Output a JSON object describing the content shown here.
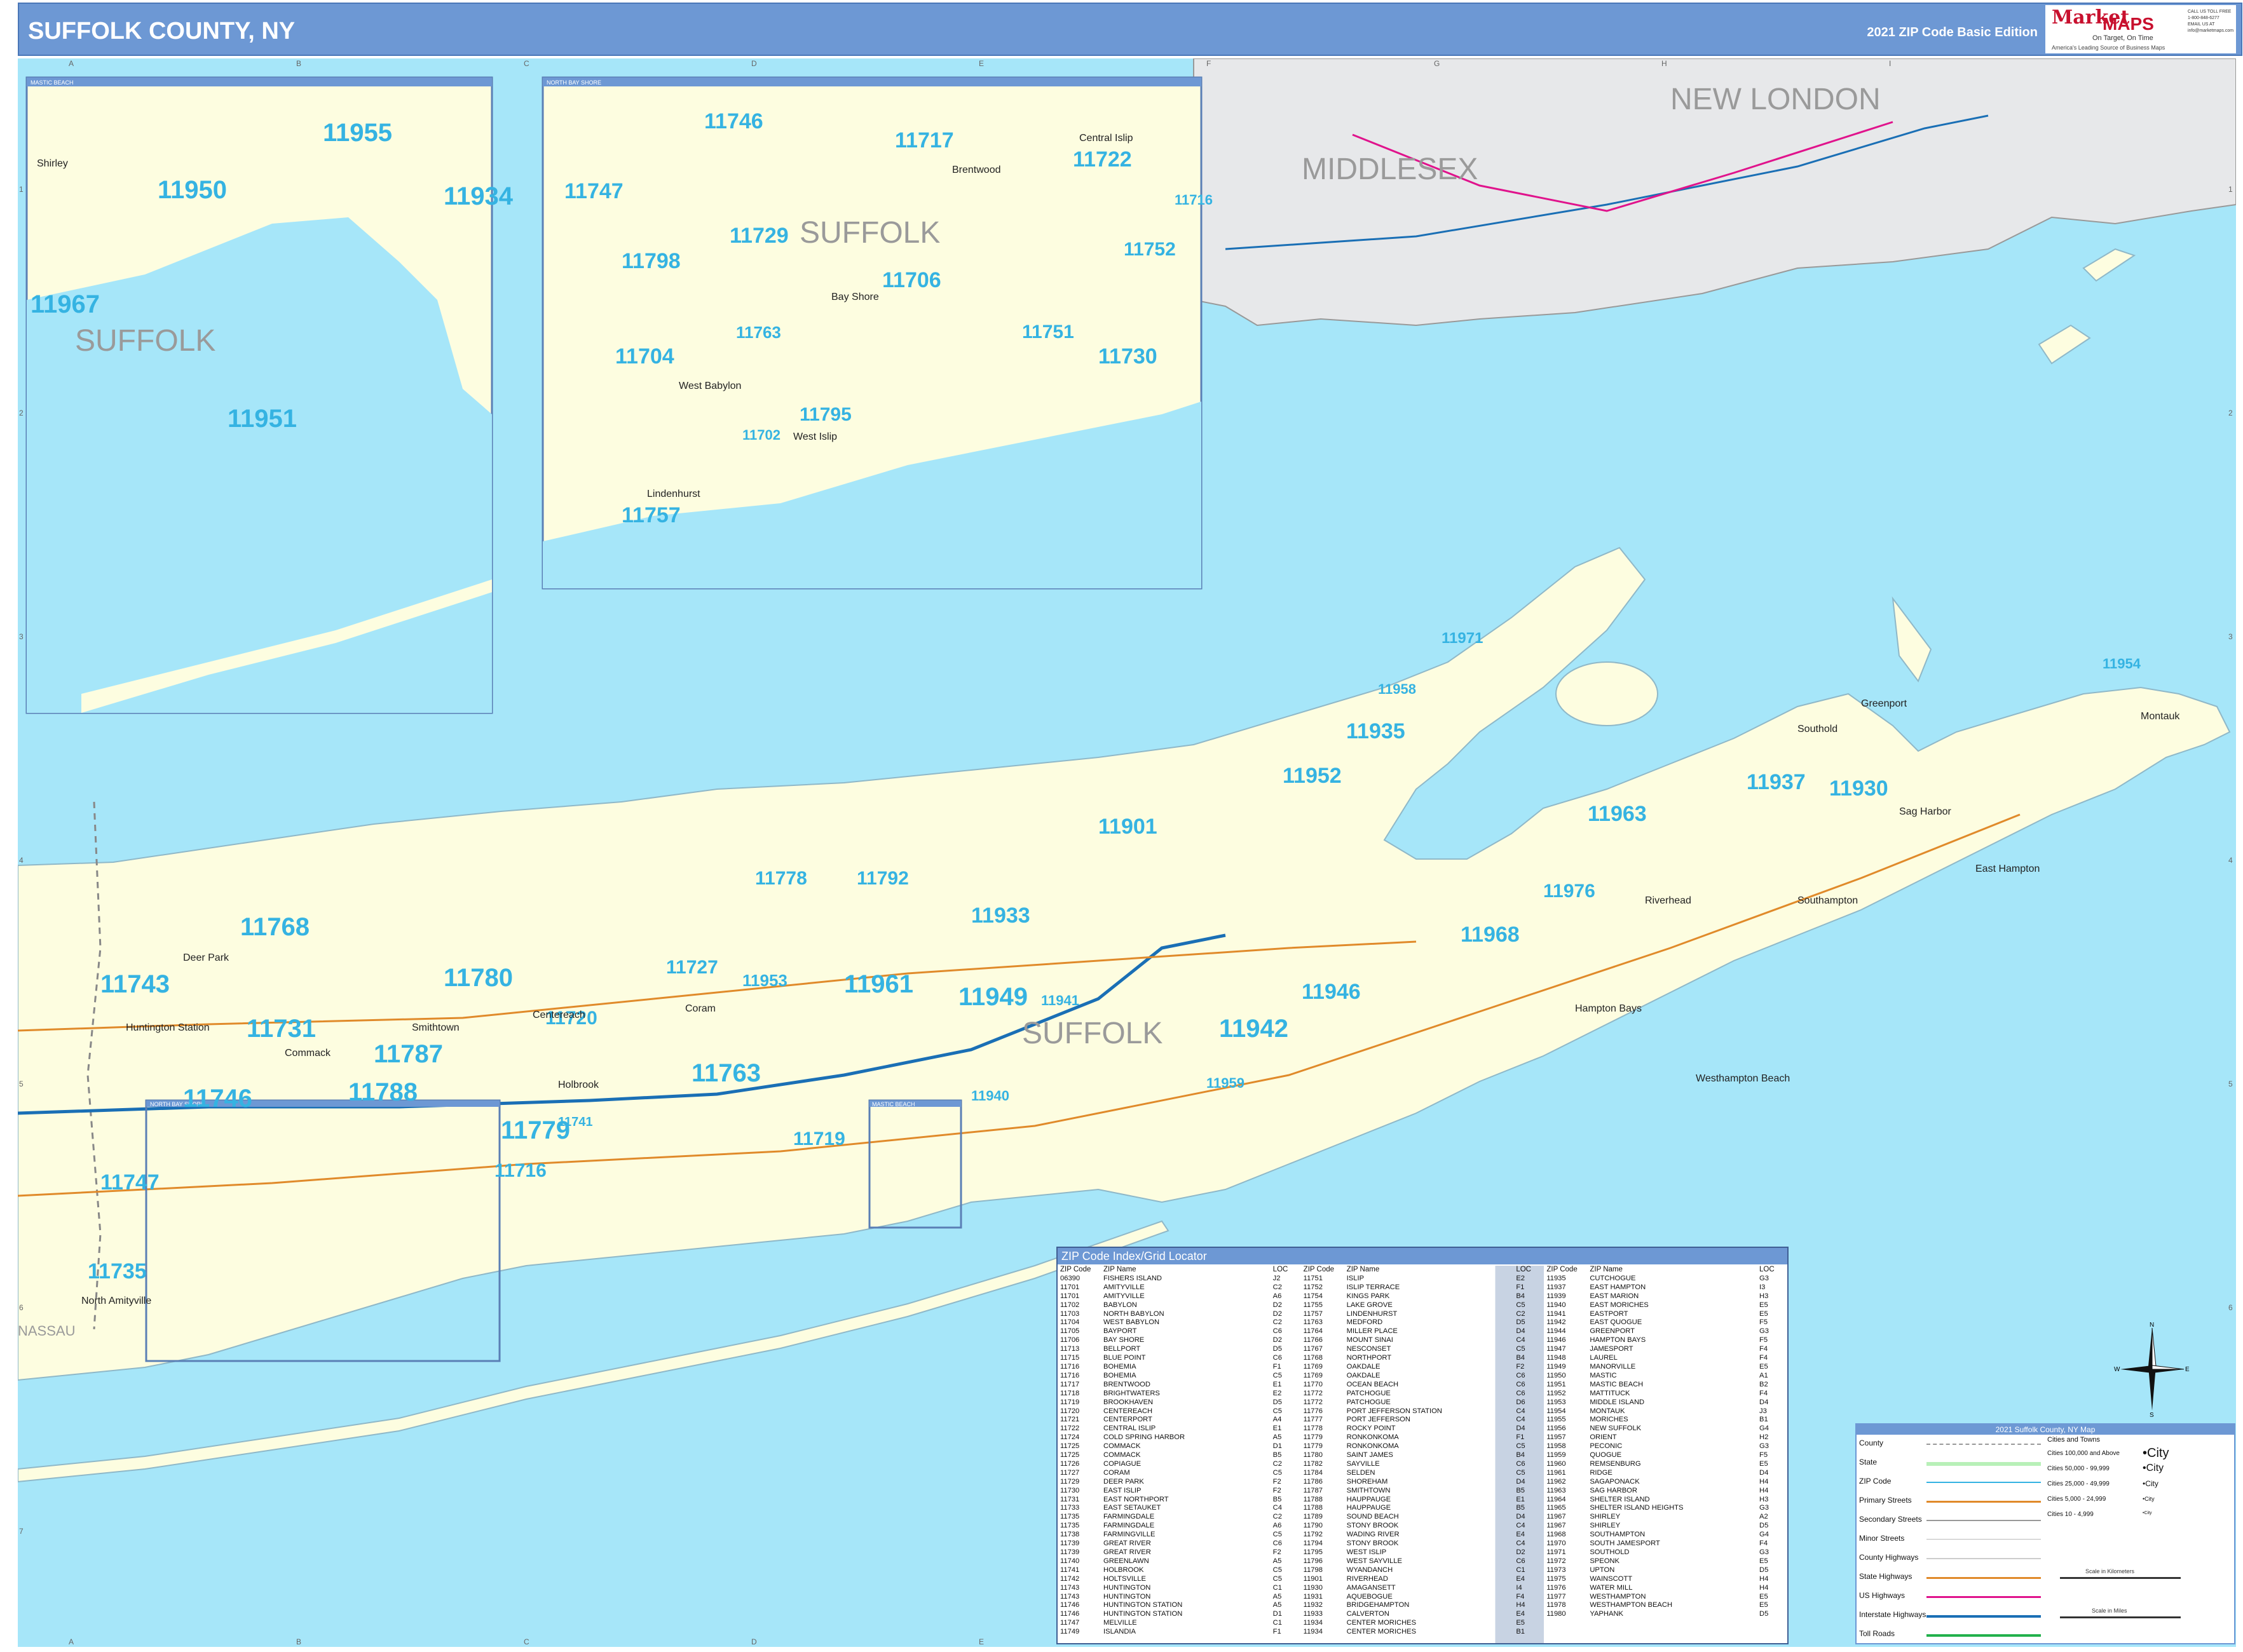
{
  "header": {
    "title": "SUFFOLK COUNTY, NY",
    "edition": "2021 ZIP Code Basic Edition",
    "logo_brand": "Market",
    "logo_maps": "MAPS",
    "logo_tagline": "On Target, On Time",
    "logo_tagline2": "America's Leading Source of Business Maps",
    "logo_contact": "CALL US TOLL FREE 1-800-848-6277 EMAIL US AT info@marketmaps.com"
  },
  "grid": {
    "columns": [
      "A",
      "B",
      "C",
      "D",
      "E",
      "F",
      "G",
      "H",
      "I"
    ],
    "rows": [
      "1",
      "2",
      "3",
      "4",
      "5",
      "6",
      "7"
    ]
  },
  "colors": {
    "water": "#a6e6f9",
    "land": "#fdfde0",
    "header": "#6d98d4",
    "zip_text": "#35b3e2",
    "ct_land": "#e7e8ea"
  },
  "map": {
    "counties": [
      "SUFFOLK",
      "SUFFOLK",
      "SUFFOLK",
      "MIDDLESEX",
      "NEW LONDON",
      "NASSAU"
    ],
    "insets": [
      {
        "title": "MASTIC BEACH"
      },
      {
        "title": "NORTH BAY SHORE"
      },
      {
        "title": "NORTH BAY SHORE"
      },
      {
        "title": "MASTIC BEACH"
      }
    ],
    "zip_labels": [
      "11955",
      "11950",
      "11934",
      "11967",
      "11951",
      "11746",
      "11717",
      "11722",
      "11747",
      "11729",
      "11798",
      "11752",
      "11706",
      "11716",
      "11763",
      "11751",
      "11704",
      "11730",
      "11795",
      "11702",
      "11757",
      "11971",
      "11958",
      "11935",
      "11952",
      "11937",
      "11930",
      "11954",
      "11963",
      "11901",
      "11778",
      "11792",
      "11933",
      "11976",
      "11968",
      "11768",
      "11743",
      "11780",
      "11727",
      "11953",
      "11961",
      "11949",
      "11941",
      "11946",
      "11731",
      "11787",
      "11720",
      "11942",
      "11763",
      "11746",
      "11788",
      "11779",
      "11741",
      "11716",
      "11719",
      "11940",
      "11959",
      "11747",
      "11735"
    ],
    "places": [
      "Shirley",
      "Brentwood",
      "Central Islip",
      "Bay Shore",
      "West Babylon",
      "West Islip",
      "Lindenhurst",
      "Huntington Station",
      "Commack",
      "Smithtown",
      "Centereach",
      "Coram",
      "Holbrook",
      "Riverhead",
      "Southold",
      "Greenport",
      "Sag Harbor",
      "Montauk",
      "Westhampton Beach",
      "Hampton Bays",
      "Southampton",
      "East Hampton",
      "North Amityville",
      "Deer Park"
    ]
  },
  "zip_index": {
    "title": "ZIP Code Index/Grid Locator",
    "headers": [
      "ZIP Code",
      "ZIP Name",
      "LOC"
    ],
    "columns": [
      [
        [
          "06390",
          "FISHERS ISLAND",
          "J2"
        ],
        [
          "11701",
          "AMITYVILLE",
          "C2"
        ],
        [
          "11701",
          "AMITYVILLE",
          "A6"
        ],
        [
          "11702",
          "BABYLON",
          "D2"
        ],
        [
          "11703",
          "NORTH BABYLON",
          "D2"
        ],
        [
          "11704",
          "WEST BABYLON",
          "C2"
        ],
        [
          "11705",
          "BAYPORT",
          "C6"
        ],
        [
          "11706",
          "BAY SHORE",
          "D2"
        ],
        [
          "11713",
          "BELLPORT",
          "D5"
        ],
        [
          "11715",
          "BLUE POINT",
          "C6"
        ],
        [
          "11716",
          "BOHEMIA",
          "F1"
        ],
        [
          "11716",
          "BOHEMIA",
          "C5"
        ],
        [
          "11717",
          "BRENTWOOD",
          "E1"
        ],
        [
          "11718",
          "BRIGHTWATERS",
          "E2"
        ],
        [
          "11719",
          "BROOKHAVEN",
          "D5"
        ],
        [
          "11720",
          "CENTEREACH",
          "C5"
        ],
        [
          "11721",
          "CENTERPORT",
          "A4"
        ],
        [
          "11722",
          "CENTRAL ISLIP",
          "E1"
        ],
        [
          "11724",
          "COLD SPRING HARBOR",
          "A5"
        ],
        [
          "11725",
          "COMMACK",
          "D1"
        ],
        [
          "11725",
          "COMMACK",
          "B5"
        ],
        [
          "11726",
          "COPIAGUE",
          "C2"
        ],
        [
          "11727",
          "CORAM",
          "C5"
        ],
        [
          "11729",
          "DEER PARK",
          "F2"
        ],
        [
          "11730",
          "EAST ISLIP",
          "F2"
        ],
        [
          "11731",
          "EAST NORTHPORT",
          "B5"
        ],
        [
          "11733",
          "EAST SETAUKET",
          "C4"
        ],
        [
          "11735",
          "FARMINGDALE",
          "C2"
        ],
        [
          "11735",
          "FARMINGDALE",
          "A6"
        ],
        [
          "11738",
          "FARMINGVILLE",
          "C5"
        ],
        [
          "11739",
          "GREAT RIVER",
          "C6"
        ],
        [
          "11739",
          "GREAT RIVER",
          "F2"
        ],
        [
          "11740",
          "GREENLAWN",
          "A5"
        ],
        [
          "11741",
          "HOLBROOK",
          "C5"
        ],
        [
          "11742",
          "HOLTSVILLE",
          "C5"
        ],
        [
          "11743",
          "HUNTINGTON",
          "C1"
        ],
        [
          "11743",
          "HUNTINGTON",
          "A5"
        ],
        [
          "11746",
          "HUNTINGTON STATION",
          "A5"
        ],
        [
          "11746",
          "HUNTINGTON STATION",
          "D1"
        ],
        [
          "11747",
          "MELVILLE",
          "C1"
        ],
        [
          "11749",
          "ISLANDIA",
          "F1"
        ]
      ],
      [
        [
          "11751",
          "ISLIP",
          "E2"
        ],
        [
          "11752",
          "ISLIP TERRACE",
          "F1"
        ],
        [
          "11754",
          "KINGS PARK",
          "B4"
        ],
        [
          "11755",
          "LAKE GROVE",
          "C5"
        ],
        [
          "11757",
          "LINDENHURST",
          "C2"
        ],
        [
          "11763",
          "MEDFORD",
          "D5"
        ],
        [
          "11764",
          "MILLER PLACE",
          "D4"
        ],
        [
          "11766",
          "MOUNT SINAI",
          "C4"
        ],
        [
          "11767",
          "NESCONSET",
          "C5"
        ],
        [
          "11768",
          "NORTHPORT",
          "B4"
        ],
        [
          "11769",
          "OAKDALE",
          "F2"
        ],
        [
          "11769",
          "OAKDALE",
          "C6"
        ],
        [
          "11770",
          "OCEAN BEACH",
          "C6"
        ],
        [
          "11772",
          "PATCHOGUE",
          "C6"
        ],
        [
          "11772",
          "PATCHOGUE",
          "D6"
        ],
        [
          "11776",
          "PORT JEFFERSON STATION",
          "C4"
        ],
        [
          "11777",
          "PORT JEFFERSON",
          "C4"
        ],
        [
          "11778",
          "ROCKY POINT",
          "D4"
        ],
        [
          "11779",
          "RONKONKOMA",
          "F1"
        ],
        [
          "11779",
          "RONKONKOMA",
          "C5"
        ],
        [
          "11780",
          "SAINT JAMES",
          "B4"
        ],
        [
          "11782",
          "SAYVILLE",
          "C6"
        ],
        [
          "11784",
          "SELDEN",
          "C5"
        ],
        [
          "11786",
          "SHOREHAM",
          "D4"
        ],
        [
          "11787",
          "SMITHTOWN",
          "B5"
        ],
        [
          "11788",
          "HAUPPAUGE",
          "E1"
        ],
        [
          "11788",
          "HAUPPAUGE",
          "B5"
        ],
        [
          "11789",
          "SOUND BEACH",
          "D4"
        ],
        [
          "11790",
          "STONY BROOK",
          "C4"
        ],
        [
          "11792",
          "WADING RIVER",
          "E4"
        ],
        [
          "11794",
          "STONY BROOK",
          "C4"
        ],
        [
          "11795",
          "WEST ISLIP",
          "D2"
        ],
        [
          "11796",
          "WEST SAYVILLE",
          "C6"
        ],
        [
          "11798",
          "WYANDANCH",
          "C1"
        ],
        [
          "11901",
          "RIVERHEAD",
          "E4"
        ],
        [
          "11930",
          "AMAGANSETT",
          "I4"
        ],
        [
          "11931",
          "AQUEBOGUE",
          "F4"
        ],
        [
          "11932",
          "BRIDGEHAMPTON",
          "H4"
        ],
        [
          "11933",
          "CALVERTON",
          "E4"
        ],
        [
          "11934",
          "CENTER MORICHES",
          "E5"
        ],
        [
          "11934",
          "CENTER MORICHES",
          "B1"
        ]
      ],
      [
        [
          "11935",
          "CUTCHOGUE",
          "G3"
        ],
        [
          "11937",
          "EAST HAMPTON",
          "I3"
        ],
        [
          "11939",
          "EAST MARION",
          "H3"
        ],
        [
          "11940",
          "EAST MORICHES",
          "E5"
        ],
        [
          "11941",
          "EASTPORT",
          "E5"
        ],
        [
          "11942",
          "EAST QUOGUE",
          "F5"
        ],
        [
          "11944",
          "GREENPORT",
          "G3"
        ],
        [
          "11946",
          "HAMPTON BAYS",
          "F5"
        ],
        [
          "11947",
          "JAMESPORT",
          "F4"
        ],
        [
          "11948",
          "LAUREL",
          "F4"
        ],
        [
          "11949",
          "MANORVILLE",
          "E5"
        ],
        [
          "11950",
          "MASTIC",
          "A1"
        ],
        [
          "11951",
          "MASTIC BEACH",
          "B2"
        ],
        [
          "11952",
          "MATTITUCK",
          "F4"
        ],
        [
          "11953",
          "MIDDLE ISLAND",
          "D4"
        ],
        [
          "11954",
          "MONTAUK",
          "J3"
        ],
        [
          "11955",
          "MORICHES",
          "B1"
        ],
        [
          "11956",
          "NEW SUFFOLK",
          "G4"
        ],
        [
          "11957",
          "ORIENT",
          "H2"
        ],
        [
          "11958",
          "PECONIC",
          "G3"
        ],
        [
          "11959",
          "QUOGUE",
          "F5"
        ],
        [
          "11960",
          "REMSENBURG",
          "E5"
        ],
        [
          "11961",
          "RIDGE",
          "D4"
        ],
        [
          "11962",
          "SAGAPONACK",
          "H4"
        ],
        [
          "11963",
          "SAG HARBOR",
          "H4"
        ],
        [
          "11964",
          "SHELTER ISLAND",
          "H3"
        ],
        [
          "11965",
          "SHELTER ISLAND HEIGHTS",
          "G3"
        ],
        [
          "11967",
          "SHIRLEY",
          "A2"
        ],
        [
          "11967",
          "SHIRLEY",
          "D5"
        ],
        [
          "11968",
          "SOUTHAMPTON",
          "G4"
        ],
        [
          "11970",
          "SOUTH JAMESPORT",
          "F4"
        ],
        [
          "11971",
          "SOUTHOLD",
          "G3"
        ],
        [
          "11972",
          "SPEONK",
          "E5"
        ],
        [
          "11973",
          "UPTON",
          "D5"
        ],
        [
          "11975",
          "WAINSCOTT",
          "H4"
        ],
        [
          "11976",
          "WATER MILL",
          "H4"
        ],
        [
          "11977",
          "WESTHAMPTON",
          "E5"
        ],
        [
          "11978",
          "WESTHAMPTON BEACH",
          "E5"
        ],
        [
          "11980",
          "YAPHANK",
          "D5"
        ]
      ]
    ]
  },
  "legend": {
    "title": "2021 Suffolk County, NY Map",
    "items": [
      "County",
      "State",
      "ZIP Code",
      "Primary Streets",
      "Secondary Streets",
      "Minor Streets",
      "County Highways",
      "State Highways",
      "US Highways",
      "Interstate Highways",
      "Toll Roads"
    ],
    "cities_header": "Cities and Towns",
    "city_tiers": [
      {
        "label": "Cities 100,000 and Above",
        "sample": "City"
      },
      {
        "label": "Cities 50,000 - 99,999",
        "sample": "City"
      },
      {
        "label": "Cities 25,000 - 49,999",
        "sample": "City"
      },
      {
        "label": "Cities 5,000 - 24,999",
        "sample": "City"
      },
      {
        "label": "Cities 10 - 4,999",
        "sample": "City"
      }
    ],
    "scale_km": "Scale in Kilometers",
    "scale_mi": "Scale in Miles"
  },
  "compass": {
    "N": "N",
    "S": "S",
    "E": "E",
    "W": "W"
  }
}
